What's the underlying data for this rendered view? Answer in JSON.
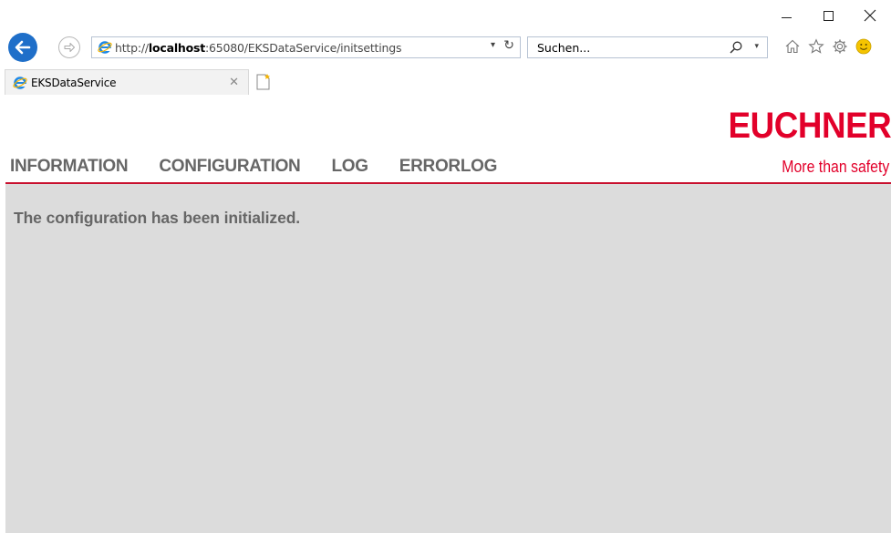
{
  "browser": {
    "address": {
      "url_prefix": "http://",
      "url_host": "localhost",
      "url_rest": ":65080/EKSDataService/initsettings"
    },
    "search": {
      "placeholder": "Suchen..."
    },
    "tab": {
      "title": "EKSDataService"
    }
  },
  "page": {
    "logo": {
      "name": "EUCHNER",
      "tagline": "More than safety"
    },
    "menu": [
      {
        "label": "INFORMATION"
      },
      {
        "label": "CONFIGURATION"
      },
      {
        "label": "LOG"
      },
      {
        "label": "ERRORLOG"
      }
    ],
    "message": "The configuration has been initialized."
  },
  "colors": {
    "brand": "#e2002a",
    "divider": "#c8102e",
    "content_bg": "#dcdcdc",
    "menu_text": "#666666",
    "back_button": "#1f6fc9"
  }
}
